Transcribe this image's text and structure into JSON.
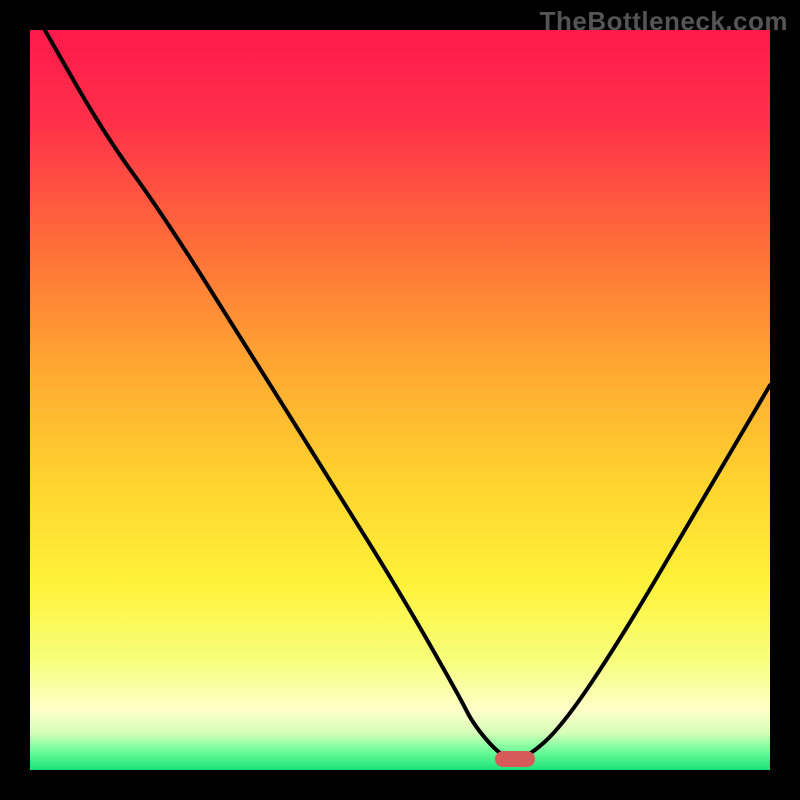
{
  "watermark": "TheBottleneck.com",
  "chart_data": {
    "type": "line",
    "title": "",
    "xlabel": "",
    "ylabel": "",
    "xlim": [
      0,
      100
    ],
    "ylim": [
      0,
      100
    ],
    "series": [
      {
        "name": "bottleneck-curve",
        "x": [
          2,
          10,
          18,
          30,
          40,
          50,
          58,
          60,
          64,
          67,
          72,
          80,
          90,
          100
        ],
        "values": [
          100,
          86,
          75,
          56,
          40,
          24,
          10,
          6,
          1.5,
          1.5,
          6,
          18,
          35,
          52
        ]
      }
    ],
    "marker": {
      "x": 65.5,
      "y": 1.5
    },
    "gradient_stops": [
      {
        "offset": 0,
        "color": "#ff1a4b"
      },
      {
        "offset": 12,
        "color": "#ff2f4a"
      },
      {
        "offset": 28,
        "color": "#ff6a3a"
      },
      {
        "offset": 45,
        "color": "#ffa631"
      },
      {
        "offset": 62,
        "color": "#ffd62e"
      },
      {
        "offset": 75,
        "color": "#fff23a"
      },
      {
        "offset": 85,
        "color": "#f7ff7a"
      },
      {
        "offset": 92,
        "color": "#fdffc9"
      },
      {
        "offset": 95,
        "color": "#d4ffb8"
      },
      {
        "offset": 97,
        "color": "#7fff9e"
      },
      {
        "offset": 100,
        "color": "#18e27a"
      }
    ]
  }
}
